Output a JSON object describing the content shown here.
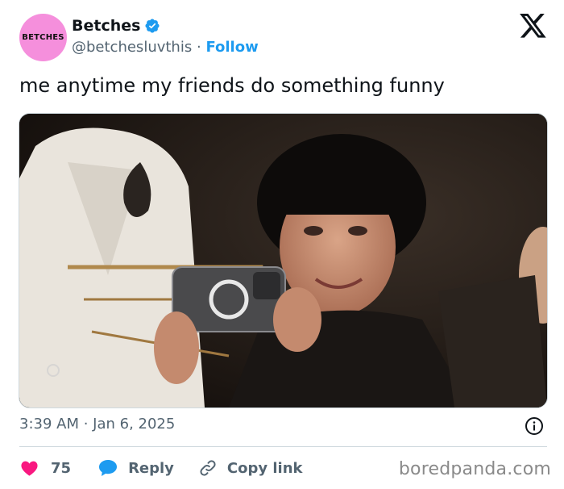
{
  "author": {
    "avatar_text": "BETCHES",
    "display_name": "Betches",
    "handle": "@betchesluvthis",
    "separator": "·",
    "follow_label": "Follow"
  },
  "tweet": {
    "text": "me anytime my friends do something funny",
    "timestamp": "3:39 AM · Jan 6, 2025"
  },
  "actions": {
    "like_count": "75",
    "reply_label": "Reply",
    "copy_link_label": "Copy link"
  },
  "watermark": "boredpanda.com",
  "colors": {
    "accent": "#1d9bf0",
    "like": "#f91880",
    "avatar_bg": "#f58fdc",
    "text_secondary": "#536471"
  },
  "icons": {
    "verified": "verified-badge-icon",
    "platform": "x-logo-icon",
    "info": "info-icon",
    "like": "heart-icon",
    "reply": "speech-bubble-icon",
    "copy": "link-icon"
  }
}
